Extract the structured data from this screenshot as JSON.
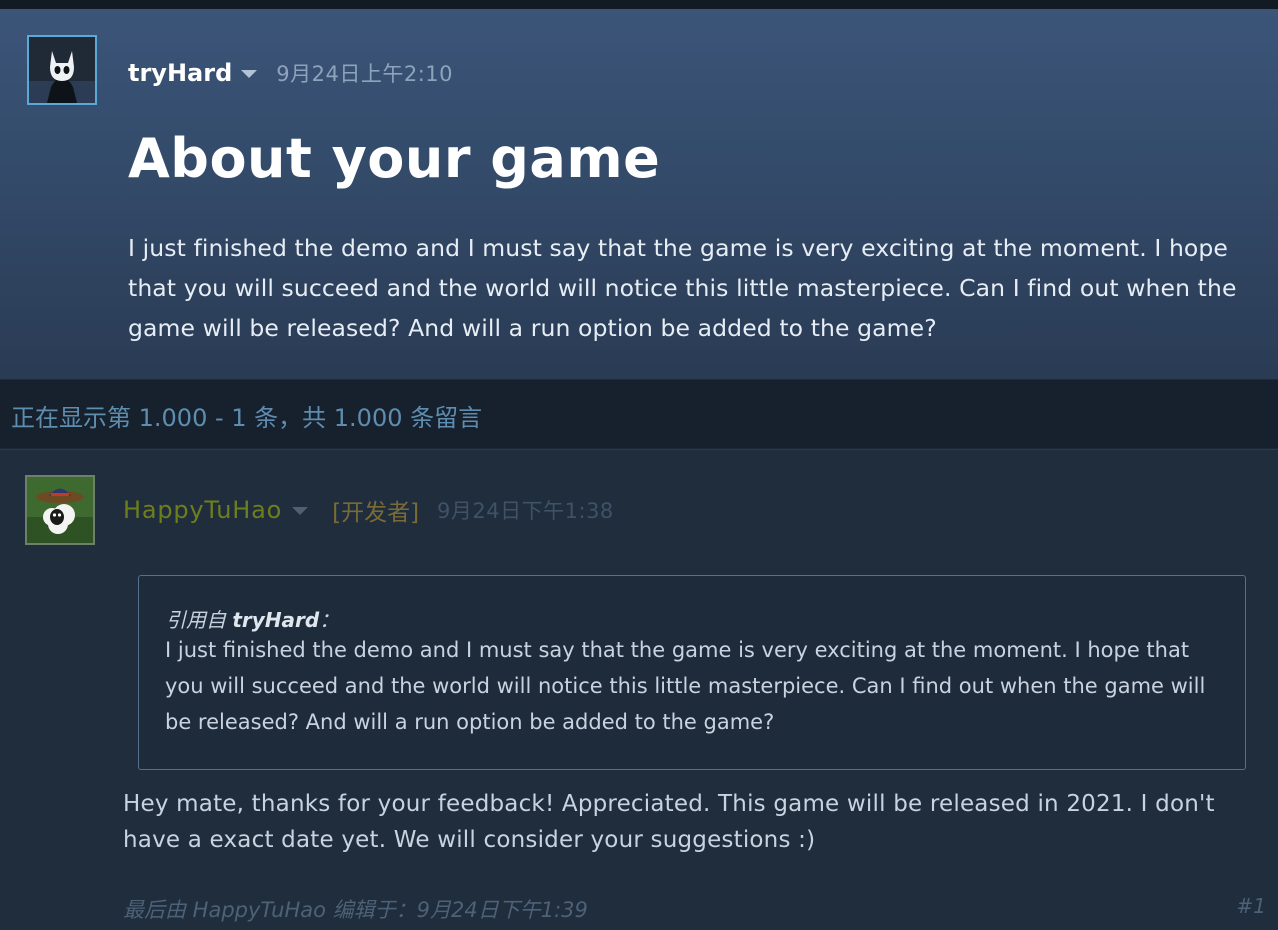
{
  "original_post": {
    "author": "tryHard",
    "timestamp": "9月24日上午2:10",
    "title": "About your game",
    "body": "I just finished the demo and I must say that the game is very exciting at the moment. I hope that you will succeed and the world will notice this little masterpiece. Can I find out when the game will be released? And will a run option be added to the game?"
  },
  "comment_count": {
    "text": "正在显示第 1.000 - 1 条，共 1.000 条留言"
  },
  "reply": {
    "author": "HappyTuHao",
    "role": "[开发者]",
    "timestamp": "9月24日下午1:38",
    "quote": {
      "prefix": "引用自 ",
      "author": "tryHard",
      "suffix": "：",
      "body": "I just finished the demo and I must say that the game is very exciting at the moment. I hope that you will succeed and the world will notice this little masterpiece. Can I find out when the game will be released? And will a run option be added to the game?"
    },
    "body": "Hey mate, thanks for your feedback! Appreciated. This game will be released in 2021. I don't have a exact date yet. We will consider your suggestions :)",
    "edited": "最后由 HappyTuHao 编辑于：9月24日下午1:39",
    "post_number": "#1"
  },
  "icons": {
    "op_avatar": "hollow-knight-avatar-icon",
    "reply_avatar": "sheep-with-sombrero-avatar-icon",
    "caret": "chevron-down-icon"
  },
  "colors": {
    "background": "#1b2838",
    "op_gradient_top": "#3b5579",
    "developer_name": "#6e7e1d",
    "count_text": "#5e8db0"
  }
}
